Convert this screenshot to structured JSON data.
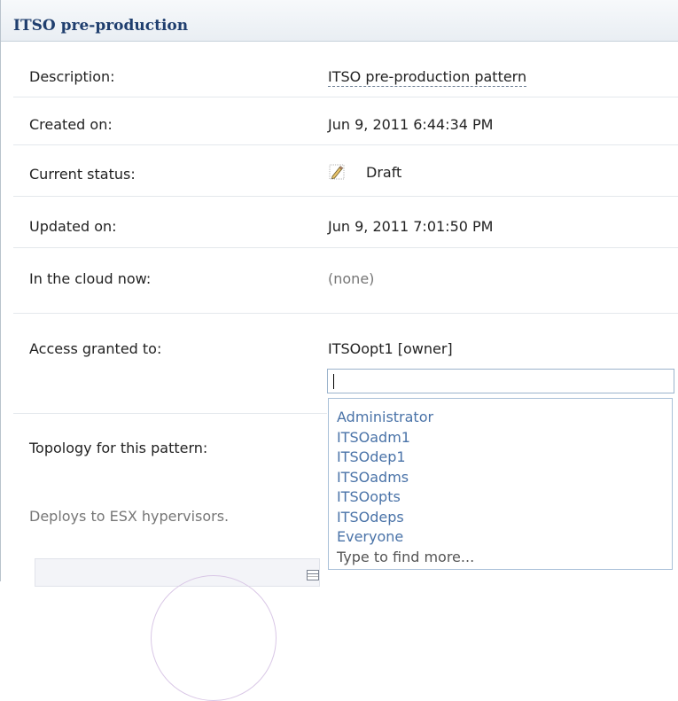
{
  "panel": {
    "title": "ITSO pre-production"
  },
  "fields": {
    "description": {
      "label": "Description:",
      "value": "ITSO pre-production pattern"
    },
    "created": {
      "label": "Created on:",
      "value": "Jun 9, 2011 6:44:34 PM"
    },
    "status": {
      "label": "Current status:",
      "value": "Draft",
      "icon": "pencil-icon"
    },
    "updated": {
      "label": "Updated on:",
      "value": "Jun 9, 2011 7:01:50 PM"
    },
    "cloud": {
      "label": "In the cloud now:",
      "value": "(none)"
    },
    "access": {
      "label": "Access granted to:",
      "value": "ITSOopt1 [owner]",
      "input_value": ""
    },
    "topology": {
      "label": "Topology for this pattern:",
      "note": "Deploys to ESX hypervisors."
    }
  },
  "dropdown": {
    "items": [
      "Administrator",
      "ITSOadm1",
      "ITSOdep1",
      "ITSOadms",
      "ITSOopts",
      "ITSOdeps",
      "Everyone"
    ],
    "hint": "Type to find more..."
  },
  "colors": {
    "title": "#1f3e6e",
    "link": "#4a73a8",
    "muted": "#767676",
    "border": "#a9c0d8"
  }
}
